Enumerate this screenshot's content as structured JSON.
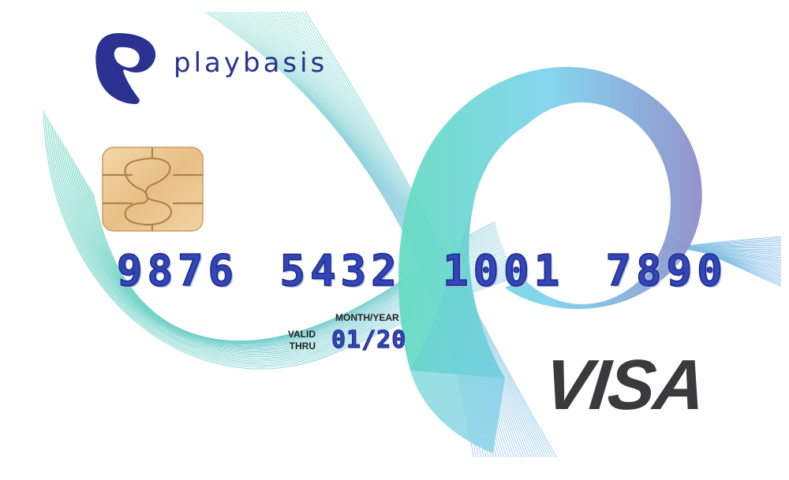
{
  "brand": {
    "name": "playbasis",
    "logo_icon": "playbasis-p-logo-icon"
  },
  "card": {
    "number": "9876 5432 1001 7890",
    "valid_label_line1": "VALID",
    "valid_label_line2": "THRU",
    "month_year_label": "MONTH/YEAR",
    "expiry": "01/20",
    "network": "VISA",
    "chip_icon": "emv-chip-icon"
  },
  "colors": {
    "brand": "#2a3190",
    "number": "#3146b8",
    "teal": "#5fd6c2",
    "sky": "#7fd0ef",
    "violet": "#8c8fca",
    "chip": "#e7c28f",
    "network": "#3a3a3c"
  }
}
